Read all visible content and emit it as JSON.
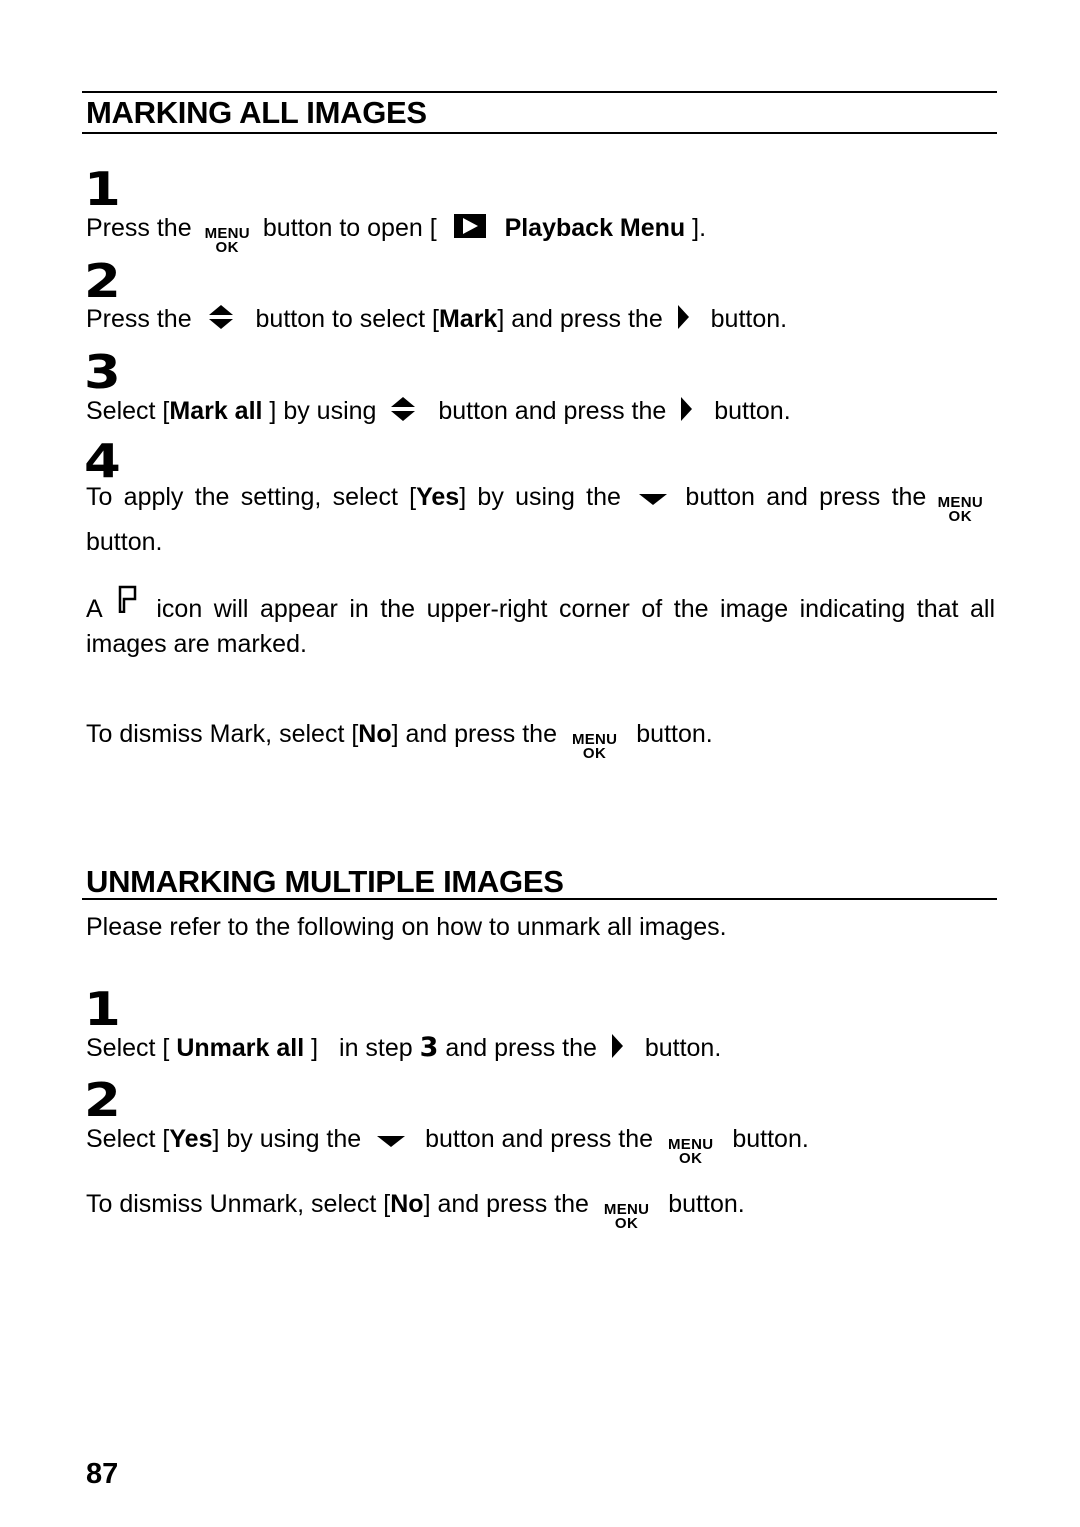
{
  "section1": {
    "title": "MARKING ALL IMAGES",
    "steps": [
      {
        "number": "1",
        "parts": [
          "Press the",
          "button to open [",
          "Playback Menu",
          "]."
        ]
      },
      {
        "number": "2",
        "parts": [
          "Press the",
          "button to select [",
          "Mark",
          "] and press the",
          "button."
        ]
      },
      {
        "number": "3",
        "parts": [
          "Select [",
          "Mark all",
          " ] by using",
          "button and press the",
          "button."
        ]
      },
      {
        "number": "4",
        "parts": [
          "To apply the setting, select [",
          "Yes",
          "] by using the",
          "button and press the",
          "button."
        ]
      }
    ],
    "note": {
      "prefix": "A",
      "text": "icon will appear in the upper-right corner of the image indicating that all images are marked."
    },
    "dismiss": [
      "To dismiss Mark, select [",
      "No",
      "] and press the",
      "button."
    ]
  },
  "section2": {
    "title": "UNMARKING MULTIPLE IMAGES",
    "intro": "Please refer to the following on how to unmark all images.",
    "steps": [
      {
        "number": "1",
        "parts": [
          "Select [ ",
          "Unmark all",
          " ]",
          "in step",
          "3",
          "and press the",
          "button."
        ]
      },
      {
        "number": "2",
        "parts": [
          "Select [",
          "Yes",
          "] by using the",
          "button and press the",
          "button."
        ]
      }
    ],
    "dismiss": [
      "To dismiss Unmark, select [",
      "No",
      "] and press the",
      "button."
    ]
  },
  "icons": {
    "menu_ok": {
      "top": "MENU",
      "bottom": "OK"
    },
    "playback": "playback-icon",
    "up_down": "up-down-arrow-icon",
    "right": "right-arrow-icon",
    "down": "down-arrow-icon",
    "mark_flag": "mark-flag-icon"
  },
  "page_number": "87"
}
